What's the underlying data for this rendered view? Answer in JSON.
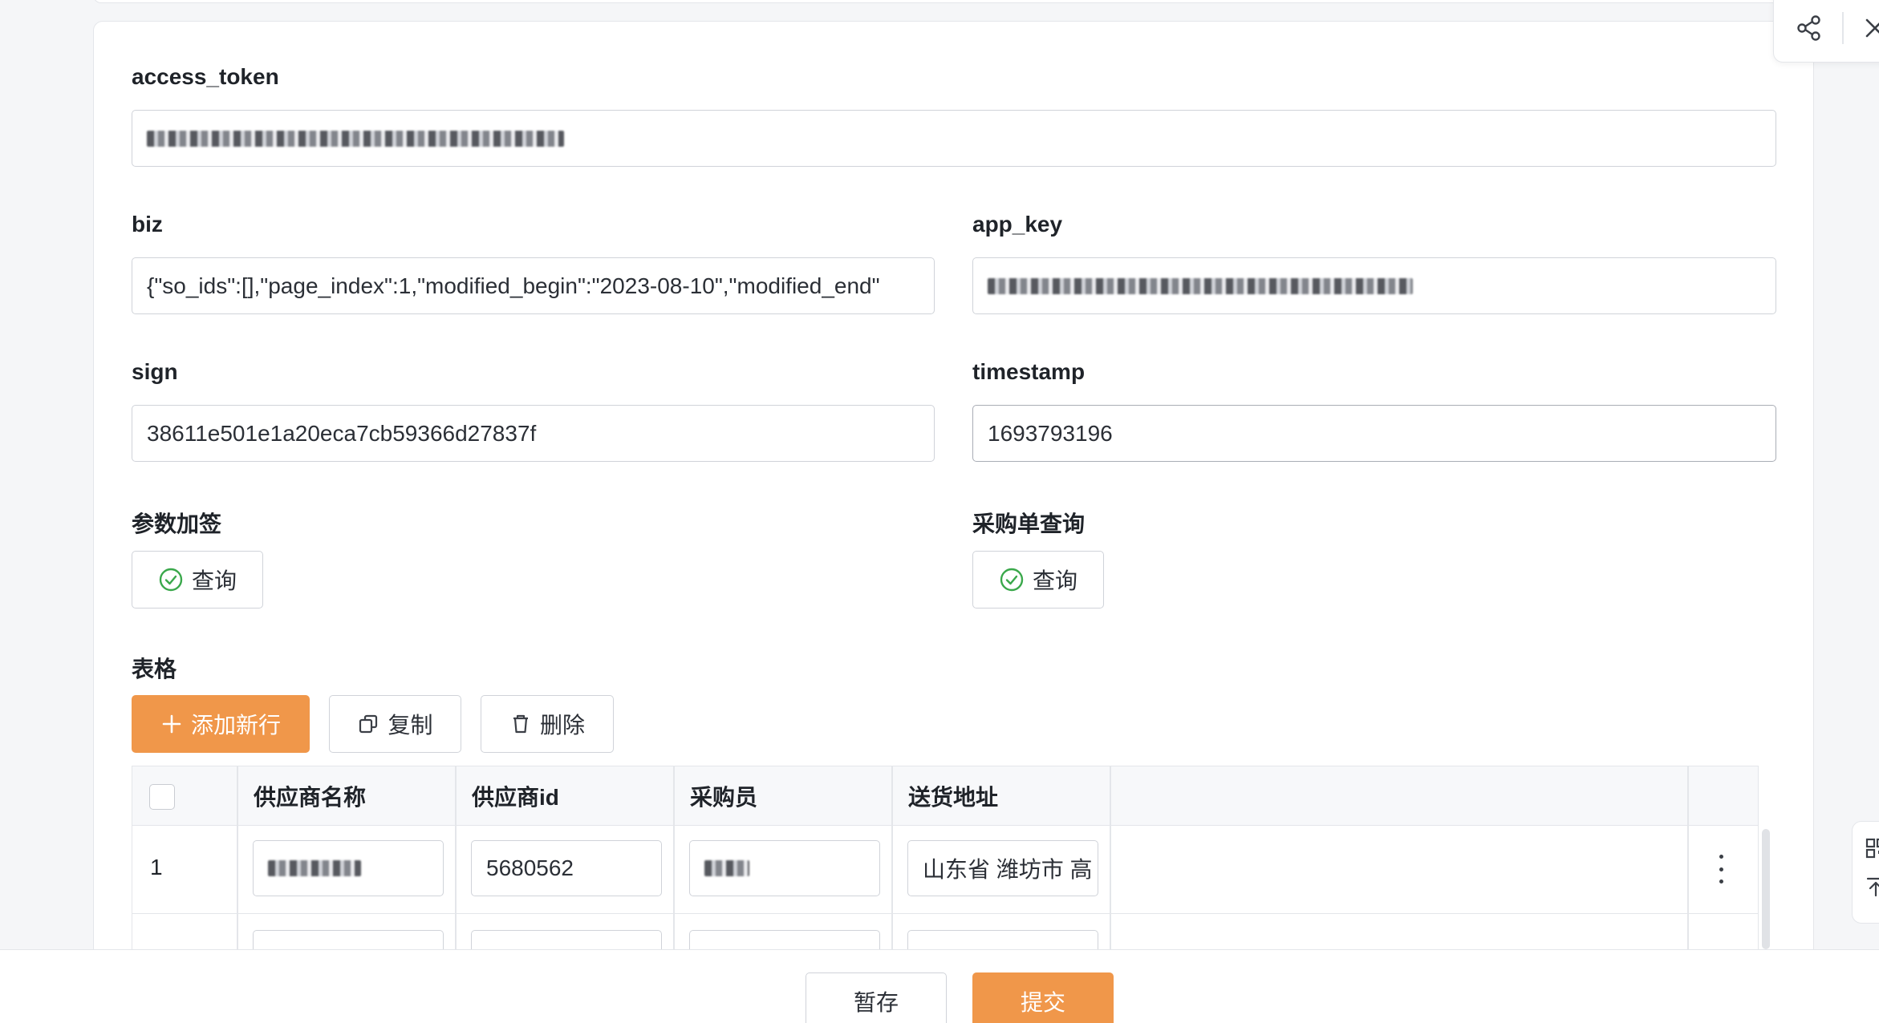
{
  "form": {
    "access_token": {
      "label": "access_token",
      "value": ""
    },
    "biz": {
      "label": "biz",
      "value": "{\"so_ids\":[],\"page_index\":1,\"modified_begin\":\"2023-08-10\",\"modified_end\""
    },
    "app_key": {
      "label": "app_key",
      "value": ""
    },
    "sign": {
      "label": "sign",
      "value": "38611e501e1a20eca7cb59366d27837f"
    },
    "timestamp": {
      "label": "timestamp",
      "value": "1693793196"
    },
    "param_sign": {
      "label": "参数加签",
      "button_label": "查询",
      "button_icon": "check-circle-icon"
    },
    "po_query": {
      "label": "采购单查询",
      "button_label": "查询",
      "button_icon": "check-circle-icon"
    }
  },
  "table_section": {
    "label": "表格",
    "toolbar": {
      "add_label": "添加新行",
      "copy_label": "复制",
      "delete_label": "删除"
    },
    "columns": [
      "供应商名称",
      "供应商id",
      "采购员",
      "送货地址"
    ],
    "rows": [
      {
        "index": "1",
        "supplier_name": "",
        "supplier_id": "5680562",
        "buyer": "",
        "address": "山东省 潍坊市 高"
      }
    ]
  },
  "footer": {
    "draft_label": "暂存",
    "submit_label": "提交"
  },
  "colors": {
    "accent": "#f0974a",
    "success_icon": "#3aa84b",
    "border": "#d0d3d9"
  }
}
